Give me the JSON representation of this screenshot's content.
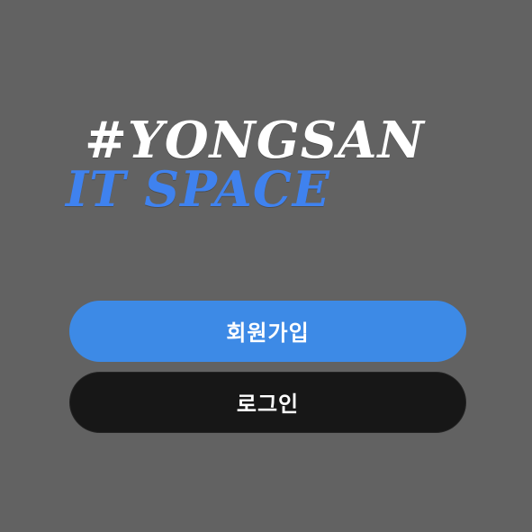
{
  "brand": {
    "line1": "#YONGSAN",
    "line2": "IT SPACE"
  },
  "actions": {
    "signup_label": "회원가입",
    "login_label": "로그인"
  },
  "colors": {
    "background": "#626262",
    "brand_line1": "#ffffff",
    "brand_line2": "#3f82ef",
    "signup_button": "#3d8ae6",
    "login_button": "#171717",
    "button_text": "#ffffff"
  }
}
